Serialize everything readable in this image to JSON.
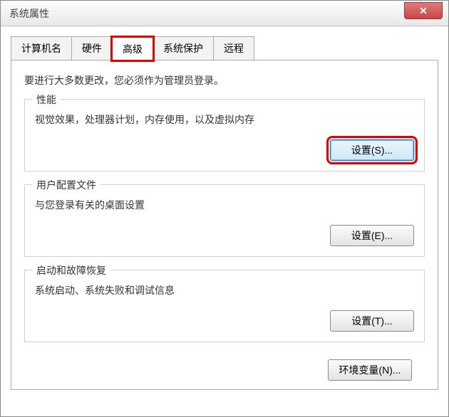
{
  "window": {
    "title": "系统属性"
  },
  "tabs": [
    {
      "label": "计算机名",
      "active": false
    },
    {
      "label": "硬件",
      "active": false
    },
    {
      "label": "高级",
      "active": true,
      "highlighted": true
    },
    {
      "label": "系统保护",
      "active": false
    },
    {
      "label": "远程",
      "active": false
    }
  ],
  "admin_note": "要进行大多数更改，您必须作为管理员登录。",
  "groups": {
    "performance": {
      "title": "性能",
      "desc": "视觉效果，处理器计划，内存使用，以及虚拟内存",
      "button": "设置(S)...",
      "button_focused": true
    },
    "userprofile": {
      "title": "用户配置文件",
      "desc": "与您登录有关的桌面设置",
      "button": "设置(E)..."
    },
    "startup": {
      "title": "启动和故障恢复",
      "desc": "系统启动、系统失败和调试信息",
      "button": "设置(T)..."
    }
  },
  "env_button": "环境变量(N)..."
}
